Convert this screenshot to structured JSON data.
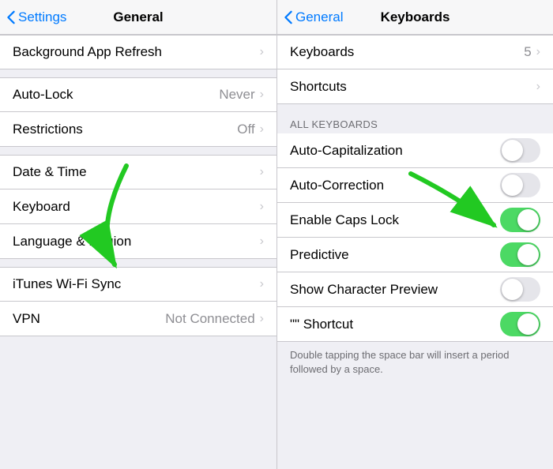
{
  "left_panel": {
    "nav": {
      "back_label": "Settings",
      "title": "General"
    },
    "groups": [
      {
        "items": [
          {
            "label": "Background App Refresh",
            "value": "",
            "chevron": true
          }
        ]
      },
      {
        "items": [
          {
            "label": "Auto-Lock",
            "value": "Never",
            "chevron": true
          },
          {
            "label": "Restrictions",
            "value": "Off",
            "chevron": true
          }
        ]
      },
      {
        "items": [
          {
            "label": "Date & Time",
            "value": "",
            "chevron": true
          },
          {
            "label": "Keyboard",
            "value": "",
            "chevron": true
          },
          {
            "label": "Language & Region",
            "value": "",
            "chevron": true
          }
        ]
      },
      {
        "items": [
          {
            "label": "iTunes Wi-Fi Sync",
            "value": "",
            "chevron": true
          },
          {
            "label": "VPN",
            "value": "Not Connected",
            "chevron": true
          }
        ]
      }
    ]
  },
  "right_panel": {
    "nav": {
      "back_label": "General",
      "title": "Keyboards"
    },
    "top_items": [
      {
        "label": "Keyboards",
        "value": "5",
        "chevron": true
      },
      {
        "label": "Shortcuts",
        "value": "",
        "chevron": true
      }
    ],
    "section_header": "ALL KEYBOARDS",
    "toggles": [
      {
        "label": "Auto-Capitalization",
        "on": false
      },
      {
        "label": "Auto-Correction",
        "on": false
      },
      {
        "label": "Enable Caps Lock",
        "on": true
      },
      {
        "label": "Predictive",
        "on": true
      },
      {
        "label": "Show Character Preview",
        "on": false
      },
      {
        "label": "\"\" Shortcut",
        "on": true
      }
    ],
    "footer": "Double tapping the space bar will insert a period followed by a space."
  },
  "colors": {
    "blue": "#007aff",
    "green_toggle": "#4cd964",
    "arrow_green": "#22c922"
  }
}
